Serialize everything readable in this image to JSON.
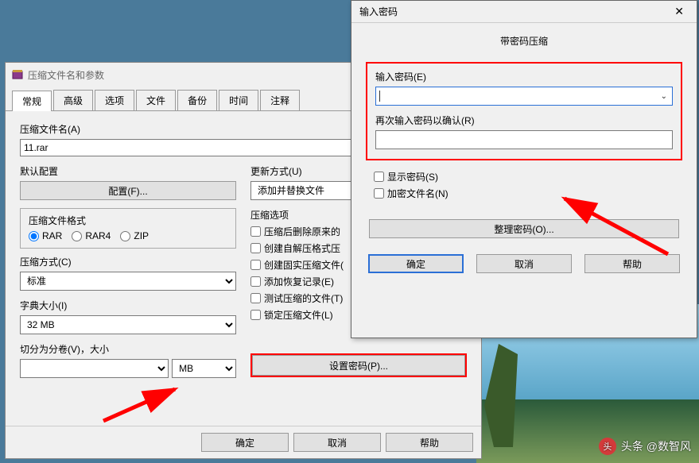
{
  "main": {
    "title": "压缩文件名和参数",
    "tabs": [
      "常规",
      "高级",
      "选项",
      "文件",
      "备份",
      "时间",
      "注释"
    ],
    "archive_name_label": "压缩文件名(A)",
    "archive_name_value": "11.rar",
    "default_profile_label": "默认配置",
    "profile_btn": "配置(F)...",
    "update_mode_label": "更新方式(U)",
    "update_mode_value": "添加并替换文件",
    "format_label": "压缩文件格式",
    "format_options": {
      "rar": "RAR",
      "rar4": "RAR4",
      "zip": "ZIP"
    },
    "compress_options_label": "压缩选项",
    "compress_options": [
      "压缩后删除原来的",
      "创建自解压格式压",
      "创建固实压缩文件(",
      "添加恢复记录(E)",
      "测试压缩的文件(T)",
      "锁定压缩文件(L)"
    ],
    "method_label": "压缩方式(C)",
    "method_value": "标准",
    "dict_label": "字典大小(I)",
    "dict_value": "32 MB",
    "split_label": "切分为分卷(V)，大小",
    "split_unit": "MB",
    "set_password_btn": "设置密码(P)...",
    "buttons": {
      "ok": "确定",
      "cancel": "取消",
      "help": "帮助"
    }
  },
  "pwd": {
    "title": "输入密码",
    "subtitle": "带密码压缩",
    "enter_label": "输入密码(E)",
    "confirm_label": "再次输入密码以确认(R)",
    "show_pwd": "显示密码(S)",
    "encrypt_names": "加密文件名(N)",
    "manage_btn": "整理密码(O)...",
    "buttons": {
      "ok": "确定",
      "cancel": "取消",
      "help": "帮助"
    }
  },
  "watermark": {
    "logo": "头",
    "text": "头条 @数智风"
  }
}
